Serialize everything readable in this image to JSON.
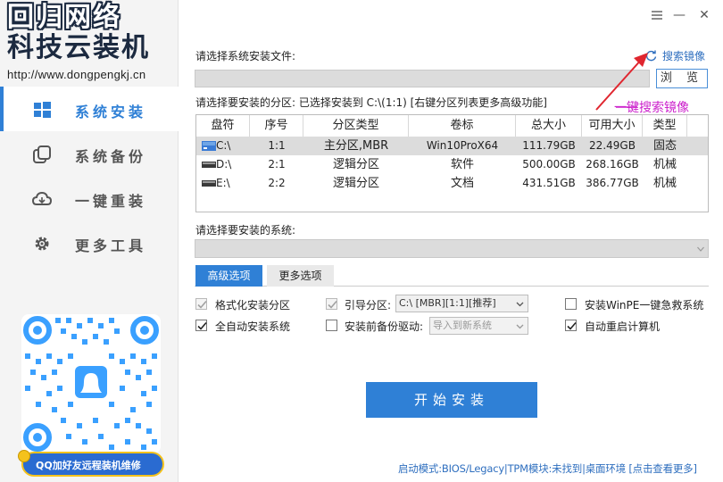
{
  "window": {
    "minimize_label": "—",
    "close_label": "✕",
    "menu_icon": "menu-icon"
  },
  "logo": {
    "line1": "回归网络",
    "line2": "科技云装机",
    "url": "http://www.dongpengkj.cn"
  },
  "sidebar": {
    "items": [
      {
        "label": "系统安装",
        "icon": "windows-icon",
        "active": true
      },
      {
        "label": "系统备份",
        "icon": "copy-icon",
        "active": false
      },
      {
        "label": "一键重装",
        "icon": "cloud-icon",
        "active": false
      },
      {
        "label": "更多工具",
        "icon": "gear-icon",
        "active": false
      }
    ],
    "qq_banner": "QQ加好友远程装机维修"
  },
  "main": {
    "file_label": "请选择系统安装文件:",
    "search_mirror": "搜索镜像",
    "browse_label": "浏 览",
    "annotation": "一键搜索镜像",
    "partition_label": "请选择要安装的分区: 已选择安装到 C:\\(1:1) [右键分区列表更多高级功能]",
    "table": {
      "headers": [
        "盘符",
        "序号",
        "分区类型",
        "卷标",
        "总大小",
        "可用大小",
        "类型"
      ],
      "rows": [
        {
          "drive": "C:\\",
          "index": "1:1",
          "ptype": "主分区,MBR",
          "volume": "Win10ProX64",
          "total": "111.79GB",
          "free": "22.49GB",
          "kind": "固态",
          "selected": true
        },
        {
          "drive": "D:\\",
          "index": "2:1",
          "ptype": "逻辑分区",
          "volume": "软件",
          "total": "500.00GB",
          "free": "268.16GB",
          "kind": "机械",
          "selected": false
        },
        {
          "drive": "E:\\",
          "index": "2:2",
          "ptype": "逻辑分区",
          "volume": "文档",
          "total": "431.51GB",
          "free": "386.77GB",
          "kind": "机械",
          "selected": false
        }
      ]
    },
    "system_label": "请选择要安装的系统:",
    "tabs": [
      "高级选项",
      "更多选项"
    ],
    "options": {
      "format": "格式化安装分区",
      "boot_partition": "引导分区:",
      "boot_value": "C:\\ [MBR][1:1][推荐]",
      "winpe": "安装WinPE一键急救系统",
      "auto_install": "全自动安装系统",
      "backup_driver": "安装前备份驱动:",
      "driver_value": "导入到新系统",
      "auto_reboot": "自动重启计算机"
    },
    "start_label": "开始安装",
    "status": "启动模式:BIOS/Legacy|TPM模块:未找到|桌面环境 [点击查看更多]"
  },
  "colors": {
    "accent": "#2f80d6",
    "sidebar_bg": "#f4f4f4",
    "annotation": "#cc22cc"
  }
}
